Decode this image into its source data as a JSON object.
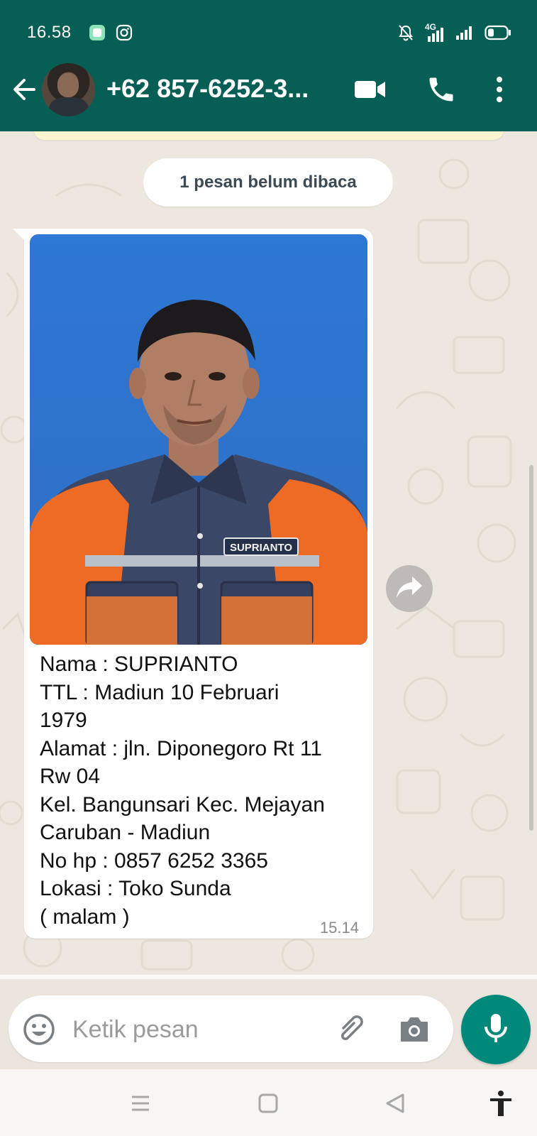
{
  "status_bar": {
    "time": "16.58",
    "left_icons": [
      "notification-app-icon",
      "instagram-icon"
    ],
    "right_icons": [
      "mute-icon",
      "signal-4g-icon",
      "signal-icon",
      "battery-icon"
    ],
    "network_label": "4G"
  },
  "header": {
    "contact_name": "+62 857-6252-3...",
    "avatar_icon": "contact-avatar",
    "actions": [
      "video-call-icon",
      "voice-call-icon",
      "more-options-icon"
    ]
  },
  "chat": {
    "unread_label": "1 pesan belum dibaca",
    "message": {
      "photo_badge_text": "SUPRIANTO",
      "caption_lines": [
        "Nama : SUPRIANTO",
        "TTL : Madiun 10 Februari",
        "1979",
        "Alamat : jln. Diponegoro Rt 11",
        "Rw 04",
        "Kel. Bangunsari Kec. Mejayan",
        "Caruban - Madiun",
        "No hp : 0857 6252 3365",
        "Lokasi : Toko Sunda",
        "( malam )"
      ],
      "time": "15.14"
    }
  },
  "input_bar": {
    "placeholder": "Ketik pesan",
    "value": ""
  },
  "nav_bar": {
    "buttons": [
      "recents-icon",
      "home-icon",
      "back-icon",
      "accessibility-icon"
    ]
  },
  "colors": {
    "header_green": "#075e54",
    "accent_teal": "#00897b",
    "chat_background": "#ede7df",
    "bubble_white": "#ffffff"
  }
}
